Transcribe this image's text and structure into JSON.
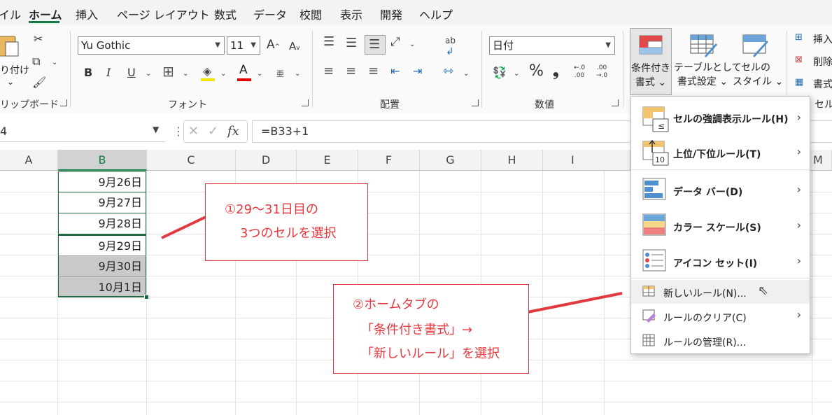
{
  "menubar": {
    "tabs": [
      "イル",
      "ホーム",
      "挿入",
      "ページ レイアウト",
      "数式",
      "データ",
      "校閲",
      "表示",
      "開発",
      "ヘルプ"
    ],
    "active_tab": "ホーム"
  },
  "ribbon": {
    "clipboard": {
      "paste_label_1": "り付け",
      "paste_label_2": "⌄",
      "group_label": "リップボード"
    },
    "font": {
      "font_name": "Yu Gothic",
      "font_size": "11",
      "bold": "B",
      "italic": "I",
      "underline": "U",
      "font_color_glyph": "A",
      "grow": "A",
      "shrink": "A",
      "phonetic": "亜",
      "group_label": "フォント"
    },
    "alignment": {
      "group_label": "配置",
      "wrap_glyph": "ab"
    },
    "number": {
      "format_value": "日付",
      "percent": "%",
      "comma": "❟",
      "group_label": "数値"
    },
    "styles": {
      "conditional_1": "条件付き",
      "conditional_2": "書式 ⌄",
      "table_1": "テーブルとして",
      "table_2": "書式設定 ⌄",
      "cell_1": "セルの",
      "cell_2": "スタイル ⌄"
    },
    "cells": {
      "insert": "挿入",
      "delete": "削除",
      "format": "書式",
      "group_label": "セル"
    }
  },
  "formula_bar": {
    "name_box": "4",
    "fx": "fx",
    "formula": "=B33+1"
  },
  "columns": [
    "A",
    "B",
    "C",
    "D",
    "E",
    "F",
    "G",
    "H",
    "I",
    "M"
  ],
  "cells_b": [
    "9月26日",
    "9月27日",
    "9月28日",
    "9月29日",
    "9月30日",
    "10月1日"
  ],
  "annotations": {
    "step1_line1": "①29～31日目の",
    "step1_line2": "3つのセルを選択",
    "step2_line1": "②ホームタブの",
    "step2_line2": "「条件付き書式」→",
    "step2_line3": "「新しいルール」を選択"
  },
  "cf_menu": {
    "highlight": "セルの強調表示ルール(H)",
    "topbottom": "上位/下位ルール(T)",
    "databar": "データ バー(D)",
    "colorscale": "カラー スケール(S)",
    "iconset": "アイコン セット(I)",
    "newrule": "新しいルール(N)...",
    "clear": "ルールのクリア(C)",
    "manage": "ルールの管理(R)..."
  },
  "colors": {
    "accent_green": "#107c41",
    "annotation_red": "#e0393e"
  }
}
